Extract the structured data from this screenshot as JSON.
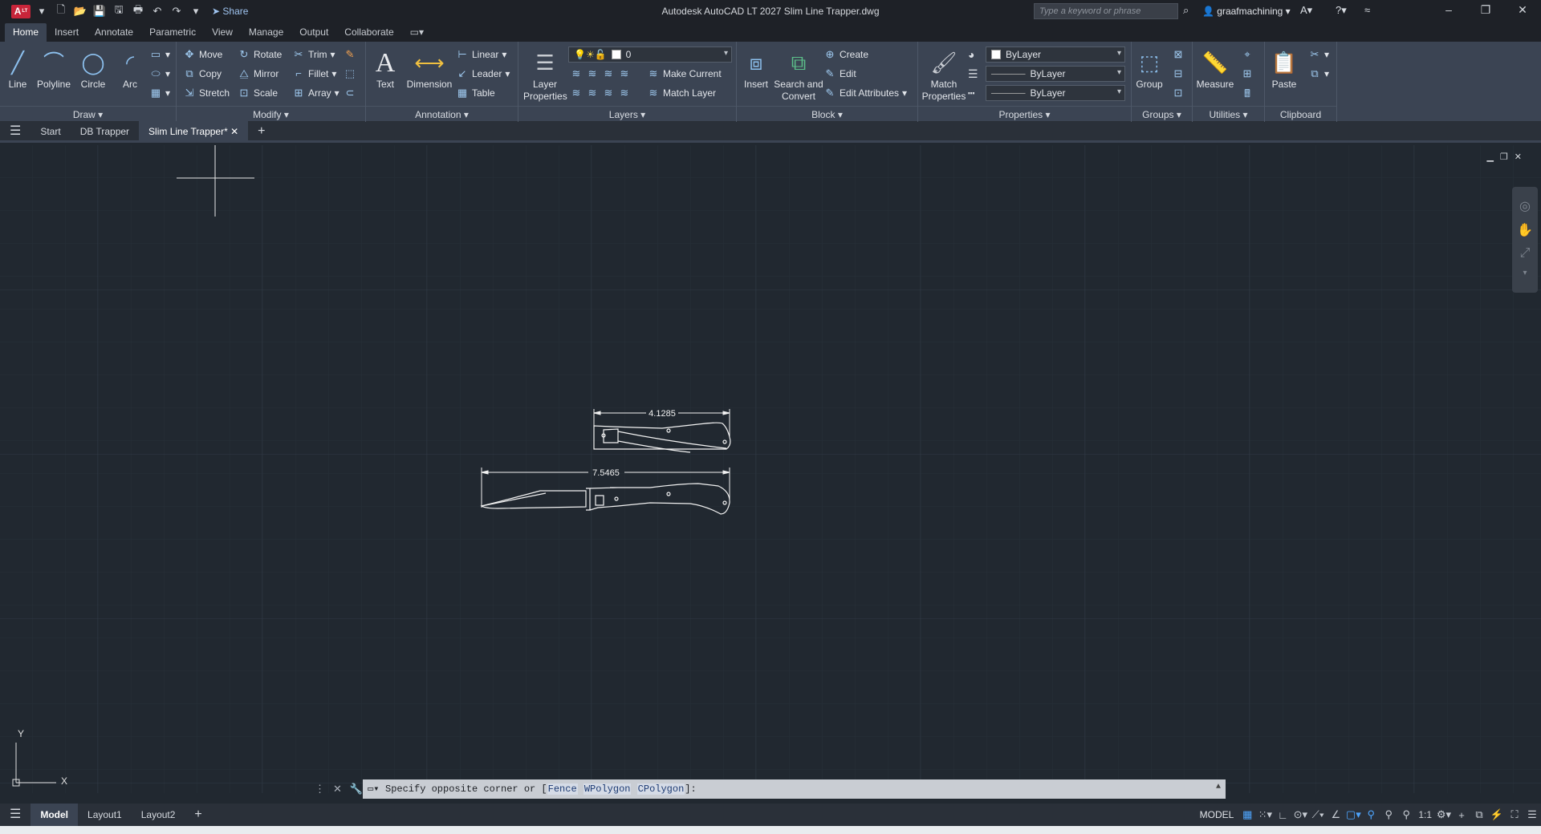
{
  "app": {
    "title": "Autodesk AutoCAD LT 2027   Slim Line Trapper.dwg",
    "logo_text": "A",
    "logo_sub": "LT",
    "share_label": "Share",
    "search_placeholder": "Type a keyword or phrase",
    "user": "graafmachining"
  },
  "ribbon_tabs": [
    "Home",
    "Insert",
    "Annotate",
    "Parametric",
    "View",
    "Manage",
    "Output",
    "Collaborate"
  ],
  "ribbon": {
    "draw": {
      "title": "Draw",
      "line": "Line",
      "polyline": "Polyline",
      "circle": "Circle",
      "arc": "Arc"
    },
    "modify": {
      "title": "Modify",
      "move": "Move",
      "rotate": "Rotate",
      "trim": "Trim",
      "copy": "Copy",
      "mirror": "Mirror",
      "fillet": "Fillet",
      "stretch": "Stretch",
      "scale": "Scale",
      "array": "Array"
    },
    "annotation": {
      "title": "Annotation",
      "text": "Text",
      "dimension": "Dimension",
      "linear": "Linear",
      "leader": "Leader",
      "table": "Table"
    },
    "layers": {
      "title": "Layers",
      "layer_properties": "Layer Properties",
      "current_layer": "0",
      "make_current": "Make Current",
      "match_layer": "Match Layer"
    },
    "block": {
      "title": "Block",
      "insert": "Insert",
      "search_convert": "Search and Convert",
      "create": "Create",
      "edit": "Edit",
      "edit_attributes": "Edit Attributes"
    },
    "properties": {
      "title": "Properties",
      "match_properties": "Match Properties",
      "color": "ByLayer",
      "linetype": "ByLayer",
      "lineweight": "ByLayer"
    },
    "groups": {
      "title": "Groups",
      "group": "Group"
    },
    "utilities": {
      "title": "Utilities",
      "measure": "Measure"
    },
    "clipboard": {
      "title": "Clipboard",
      "paste": "Paste"
    }
  },
  "file_tabs": [
    "Start",
    "DB Trapper",
    "Slim Line Trapper*"
  ],
  "drawing": {
    "dim_top": "4.1285",
    "dim_bottom": "7.5465"
  },
  "ucs": {
    "x": "X",
    "y": "Y"
  },
  "command": {
    "prompt": "Specify opposite corner or [",
    "opt1": "Fence",
    "opt2": "WPolygon",
    "opt3": "CPolygon",
    "suffix": "]:"
  },
  "layout_tabs": [
    "Model",
    "Layout1",
    "Layout2"
  ],
  "status": {
    "mode": "MODEL",
    "scale": "1:1"
  }
}
